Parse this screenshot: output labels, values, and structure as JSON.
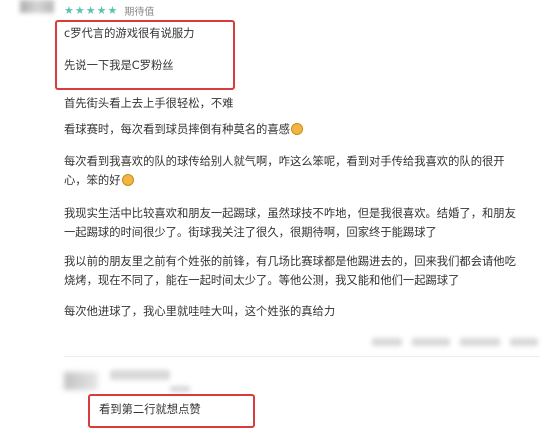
{
  "review": {
    "stars": [
      "★",
      "★",
      "★",
      "★",
      "★"
    ],
    "rating_label": "期待值",
    "star_color": "#5ec2b0",
    "paragraphs": {
      "p1": "c罗代言的游戏很有说服力",
      "p2": "先说一下我是C罗粉丝",
      "p3": "首先街头看上去上手很轻松，不难",
      "p4": "看球赛时，每次看到球员摔倒有种莫名的喜感",
      "p5": "每次看到我喜欢的队的球传给别人就气啊，咋这么笨呢，看到对手传给我喜欢的队的很开心，笨的好",
      "p6": "我现实生活中比较喜欢和朋友一起踢球，虽然球技不咋地，但是我很喜欢。结婚了，和朋友一起踢球的时间很少了。街球我关注了很久，很期待啊，回家终于能踢球了",
      "p7": "我以前的朋友里之前有个姓张的前锋，有几场比赛球都是他踢进去的，回来我们都会请他吃烧烤，现在不同了，能在一起时间太少了。等他公测，我又能和他们一起踢球了",
      "p8": "每次他进球了，我心里就哇哇大叫，这个姓张的真给力"
    }
  },
  "reply": {
    "text": "看到第二行就想点赞"
  },
  "highlight_color": "#d93c3c"
}
